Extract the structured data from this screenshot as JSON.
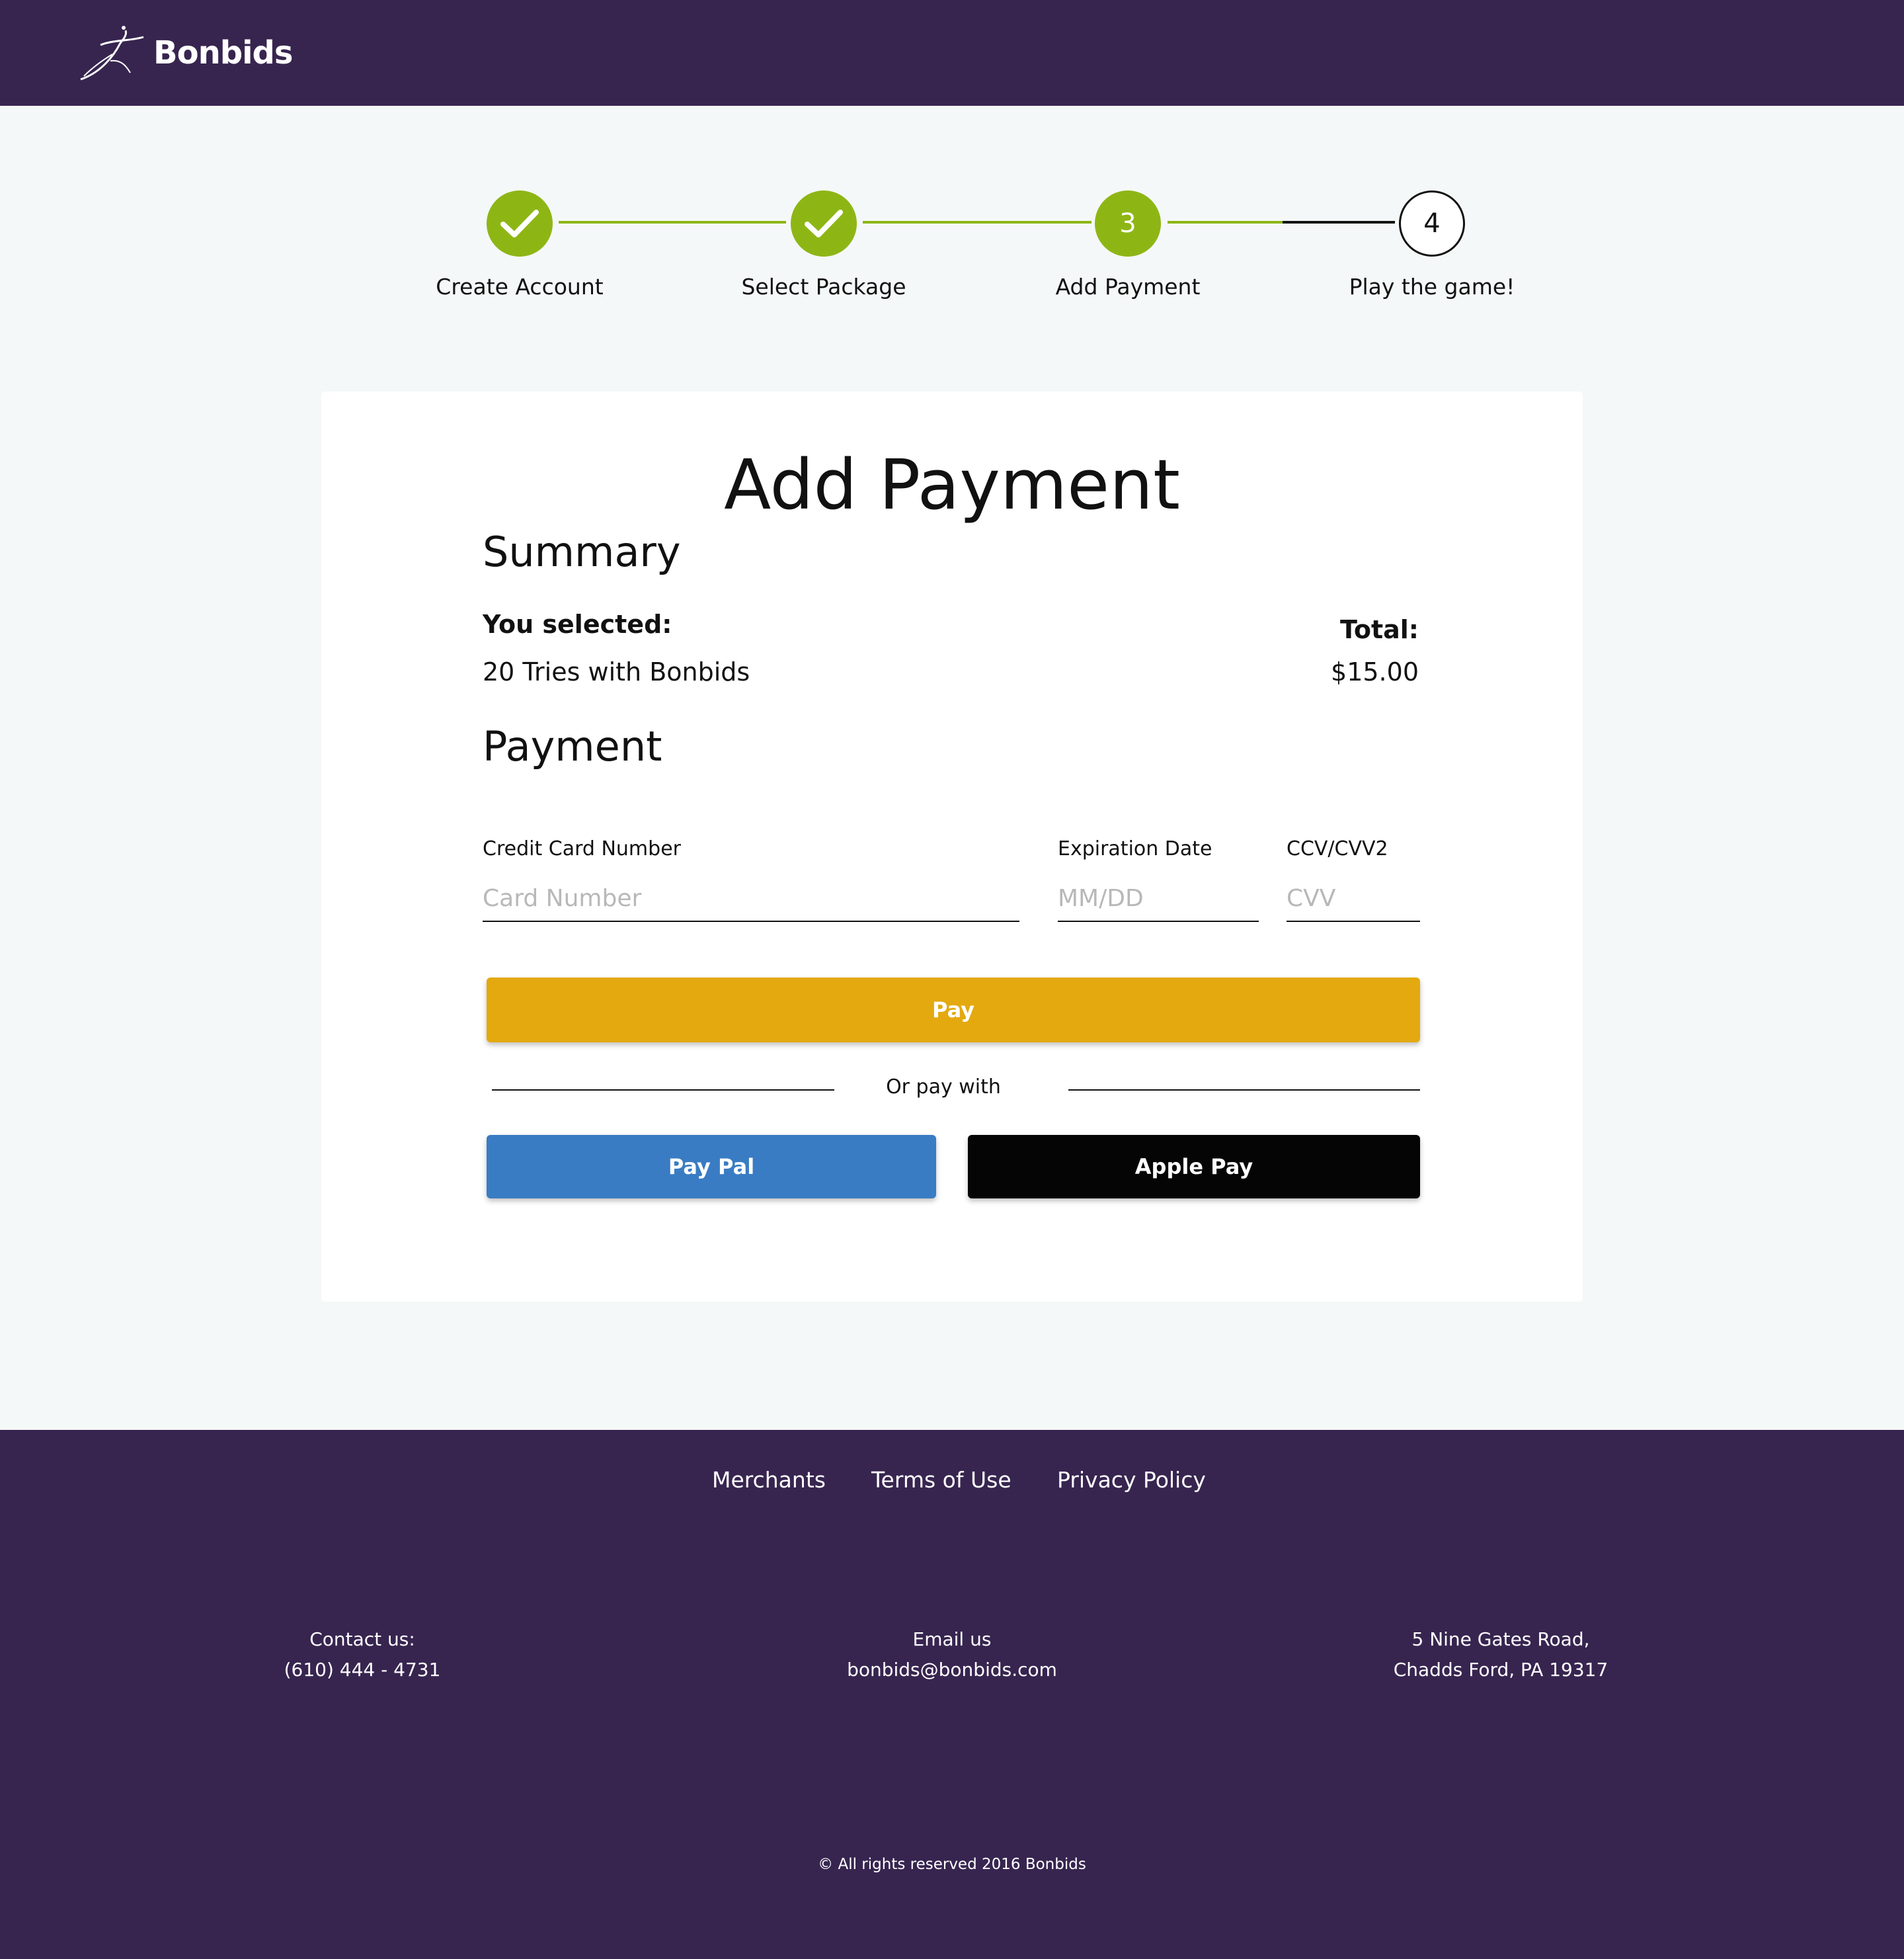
{
  "header": {
    "brand": "Bonbids"
  },
  "stepper": {
    "steps": [
      {
        "label": "Create Account",
        "status": "done",
        "number": ""
      },
      {
        "label": "Select Package",
        "status": "done",
        "number": ""
      },
      {
        "label": "Add Payment",
        "status": "current",
        "number": "3"
      },
      {
        "label": "Play the game!",
        "status": "todo",
        "number": "4"
      }
    ]
  },
  "card": {
    "title": "Add Payment",
    "summary_heading": "Summary",
    "selected_label": "You selected:",
    "selected_value": "20 Tries with Bonbids",
    "total_label": "Total:",
    "total_value": "$15.00",
    "payment_heading": "Payment",
    "card_number_label": "Credit Card Number",
    "card_number_placeholder": "Card Number",
    "expiration_label": "Expiration Date",
    "expiration_placeholder": "MM/DD",
    "cvv_label": "CCV/CVV2",
    "cvv_placeholder": "CVV",
    "pay_label": "Pay",
    "or_pay_with": "Or pay with",
    "paypal_label": "Pay Pal",
    "applepay_label": "Apple Pay"
  },
  "footer": {
    "links": [
      "Merchants",
      "Terms of Use",
      "Privacy Policy"
    ],
    "contact_label": "Contact us:",
    "contact_phone": "(610) 444 - 4731",
    "email_label": "Email us",
    "email_value": "bonbids@bonbids.com",
    "address_line1": "5 Nine Gates Road,",
    "address_line2": "Chadds Ford, PA 19317",
    "copyright": "© All rights reserved 2016 Bonbids"
  },
  "colors": {
    "brand_purple": "#372550",
    "step_green": "#8db615",
    "pay_gold": "#e3a90f",
    "paypal_blue": "#3a7cc3",
    "applepay_black": "#050505"
  }
}
